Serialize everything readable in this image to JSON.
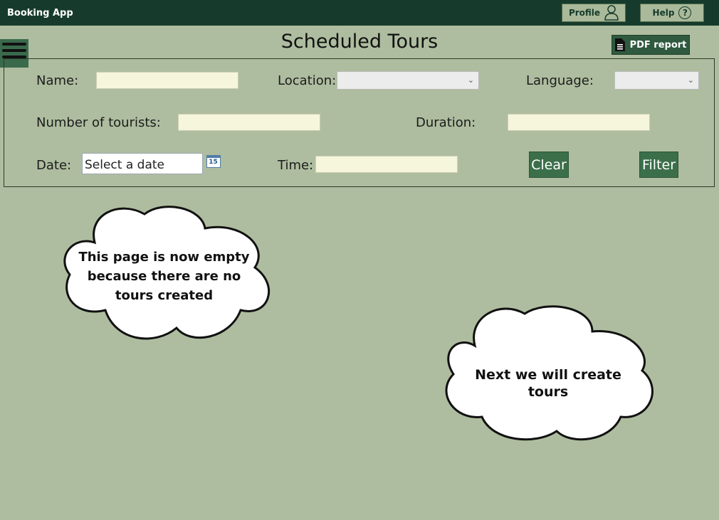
{
  "titlebar": {
    "app_title": "Booking App",
    "profile_label": "Profile",
    "help_label": "Help",
    "help_symbol": "?"
  },
  "page": {
    "title": "Scheduled Tours",
    "pdf_report_label": "PDF report"
  },
  "filters": {
    "name_label": "Name:",
    "name_value": "",
    "location_label": "Location:",
    "location_value": "",
    "language_label": "Language:",
    "language_value": "",
    "tourists_label": "Number of tourists:",
    "tourists_value": "",
    "duration_label": "Duration:",
    "duration_value": "",
    "date_label": "Date:",
    "date_placeholder": "Select a date",
    "calendar_day": "15",
    "time_label": "Time:",
    "time_value": "",
    "clear_label": "Clear",
    "filter_label": "Filter"
  },
  "notes": {
    "empty_message": "This page is now empty because there are no tours created",
    "next_message": "Next we will create tours"
  },
  "colors": {
    "titlebar": "#163b2c",
    "background": "#aebd9f",
    "button_green": "#3b6f4a",
    "input_fill": "#f6f6dc"
  }
}
